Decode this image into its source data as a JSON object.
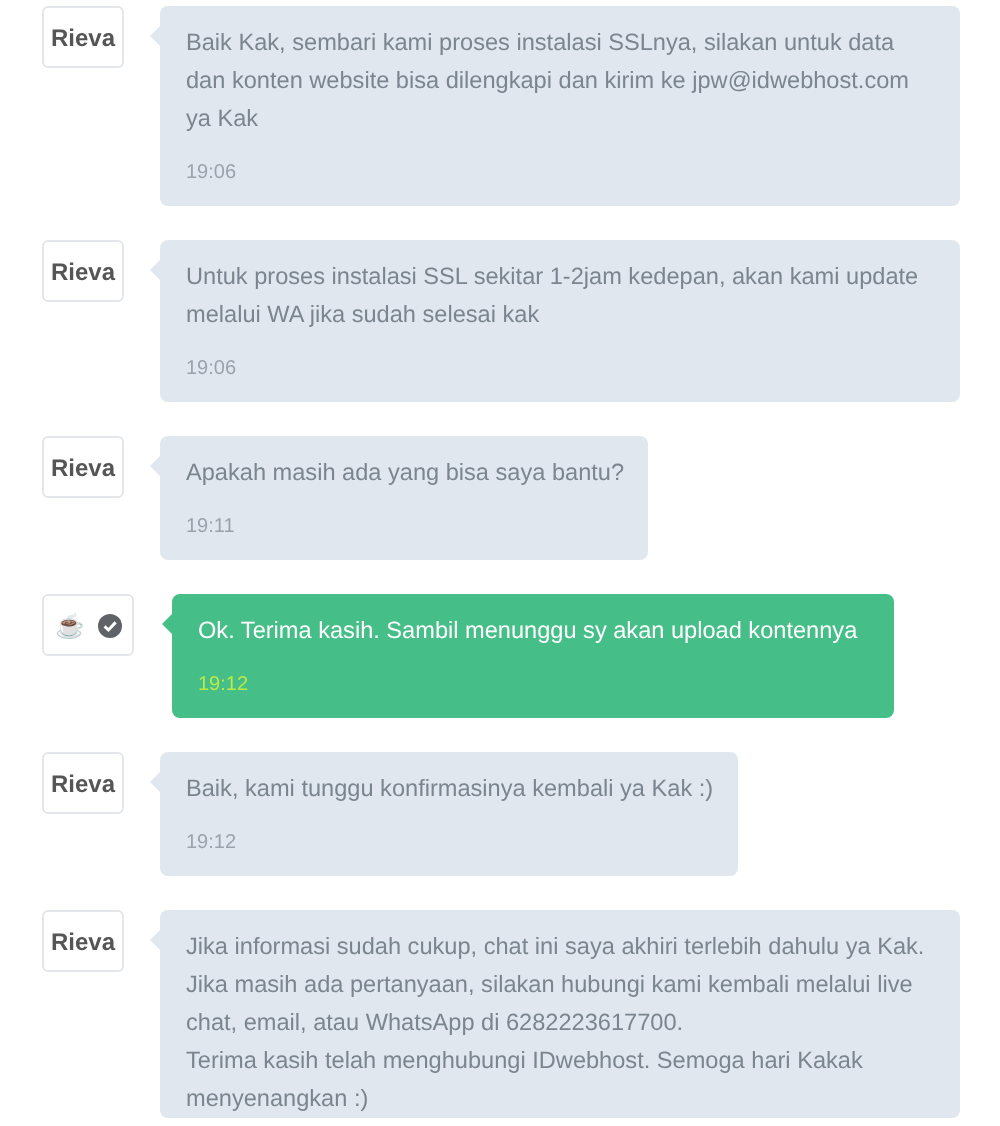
{
  "messages": [
    {
      "kind": "agent",
      "sender": "Rieva",
      "text": "Baik Kak, sembari kami proses instalasi SSLnya, silakan untuk data dan konten website bisa dilengkapi dan kirim ke jpw@idwebhost.com ya Kak",
      "time": "19:06"
    },
    {
      "kind": "agent",
      "sender": "Rieva",
      "text": "Untuk proses instalasi SSL sekitar 1-2jam kedepan, akan kami update melalui WA jika sudah selesai kak",
      "time": "19:06"
    },
    {
      "kind": "agent",
      "sender": "Rieva",
      "text": "Apakah masih ada yang bisa saya bantu?",
      "time": "19:11"
    },
    {
      "kind": "user",
      "avatar": "☕",
      "verified": true,
      "text": "Ok. Terima kasih. Sambil menunggu sy akan upload kontennya",
      "time": "19:12"
    },
    {
      "kind": "agent",
      "sender": "Rieva",
      "text": "Baik, kami tunggu konfirmasinya kembali ya Kak :)",
      "time": "19:12"
    },
    {
      "kind": "agent",
      "sender": "Rieva",
      "text": "Jika informasi sudah cukup, chat ini saya akhiri terlebih dahulu ya Kak. Jika masih ada pertanyaan, silakan hubungi kami kembali melalui live chat, email, atau WhatsApp di 6282223617700.\nTerima kasih telah menghubungi IDwebhost. Semoga hari Kakak menyenangkan :)"
    }
  ]
}
